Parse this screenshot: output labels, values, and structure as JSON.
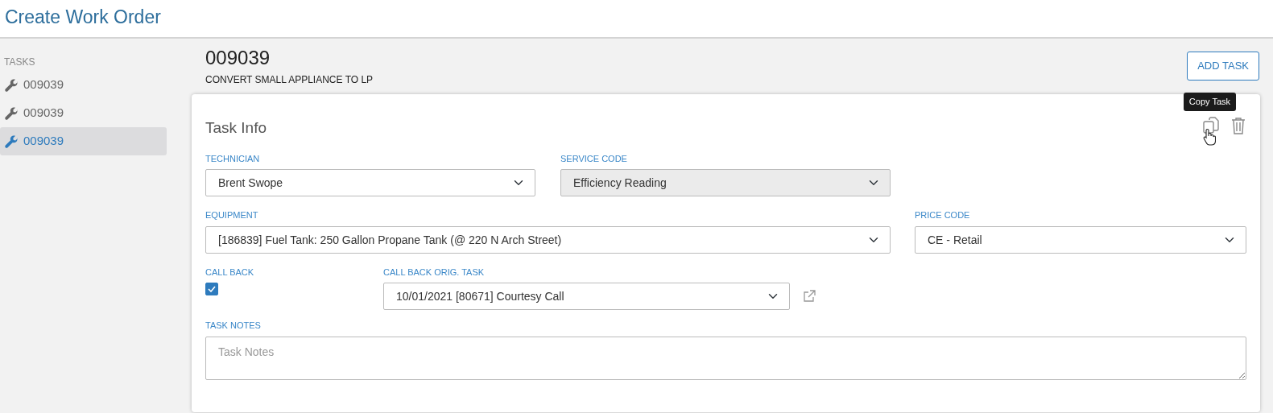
{
  "page_title": "Create Work Order",
  "sidebar": {
    "heading": "TASKS",
    "items": [
      {
        "label": "009039",
        "selected": false
      },
      {
        "label": "009039",
        "selected": false
      },
      {
        "label": "009039",
        "selected": true
      }
    ]
  },
  "task": {
    "number": "009039",
    "description": "CONVERT SMALL APPLIANCE TO LP"
  },
  "add_task_button": "ADD TASK",
  "card": {
    "title": "Task Info",
    "tooltip": "Copy Task",
    "technician": {
      "label": "TECHNICIAN",
      "value": "Brent Swope",
      "disabled": false
    },
    "service_code": {
      "label": "SERVICE CODE",
      "value": "Efficiency Reading",
      "disabled": true
    },
    "equipment": {
      "label": "EQUIPMENT",
      "value": "[186839] Fuel Tank: 250 Gallon Propane Tank (@ 220 N Arch Street)",
      "disabled": false
    },
    "price_code": {
      "label": "PRICE CODE",
      "value": "CE - Retail",
      "disabled": false
    },
    "call_back": {
      "label": "CALL BACK",
      "checked": true
    },
    "call_back_orig_task": {
      "label": "CALL BACK ORIG. TASK",
      "value": "10/01/2021 [80671] Courtesy Call",
      "disabled": false
    },
    "task_notes": {
      "label": "TASK NOTES",
      "placeholder": "Task Notes"
    }
  }
}
